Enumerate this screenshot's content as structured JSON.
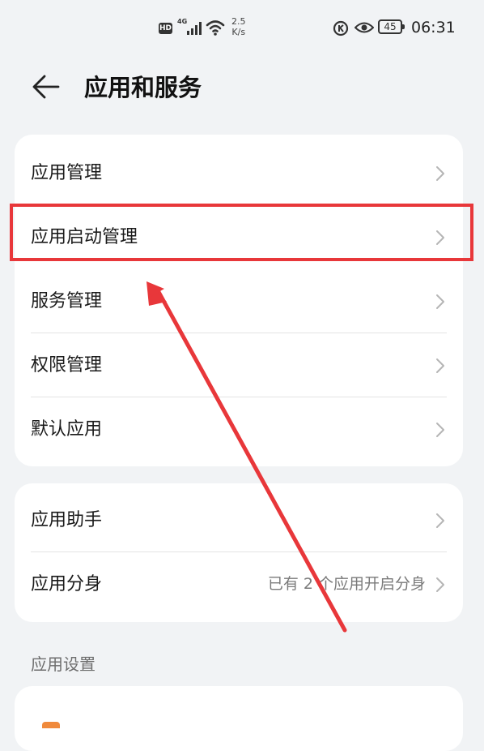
{
  "status_bar": {
    "hd": "HD",
    "network": "4G",
    "speed_value": "2.5",
    "speed_unit": "K/s",
    "battery": "45",
    "time": "06:31"
  },
  "header": {
    "title": "应用和服务"
  },
  "card1": {
    "items": [
      {
        "label": "应用管理"
      },
      {
        "label": "应用启动管理"
      },
      {
        "label": "服务管理"
      },
      {
        "label": "权限管理"
      },
      {
        "label": "默认应用"
      }
    ]
  },
  "card2": {
    "items": [
      {
        "label": "应用助手"
      },
      {
        "label": "应用分身",
        "value": "已有 2 个应用开启分身"
      }
    ]
  },
  "section": {
    "label": "应用设置"
  },
  "colors": {
    "background": "#f1f3f5",
    "card": "#ffffff",
    "annotation": "#e8373a",
    "app_icon": "#f08a3c"
  },
  "annotation": {
    "highlighted_item": "应用启动管理"
  }
}
